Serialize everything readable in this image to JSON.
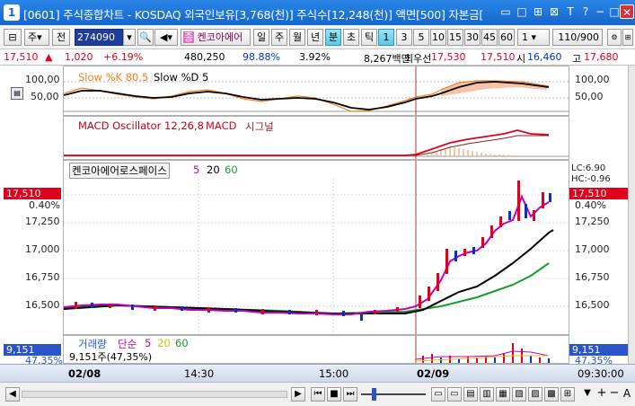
{
  "window": {
    "title": "[0601] 주식종합차트 - KOSDAQ 외국인보유[3,768(천)] 주식수[12,248(천)] 액면[500] 자본금[",
    "icon_label": "1",
    "buttons": [
      "▭",
      "□",
      "⊞",
      "⊠",
      "T",
      "?",
      "-",
      "□",
      "✕"
    ]
  },
  "toolbar": {
    "market": "주",
    "period_btn": "전",
    "code": "274090",
    "stock_name": "켄코아에어",
    "period_buttons": [
      "일",
      "주",
      "월",
      "년",
      "분",
      "초",
      "틱"
    ],
    "interval_buttons": [
      "1",
      "3",
      "5",
      "10",
      "15",
      "30",
      "45",
      "60"
    ],
    "multiplier": "1",
    "count": "110/900"
  },
  "infobar": {
    "price": "17,510",
    "arrow": "▲",
    "change": "1,020",
    "change_pct": "+6.19%",
    "volume": "480,250",
    "vol_ratio": "98.88%",
    "turnover": "3.92%",
    "amount": "8,267백만",
    "priority_label": "최우선",
    "ask": "17,530",
    "bid": "17,510",
    "open_label": "시",
    "open": "16,460",
    "high_label": "고",
    "high": "17,680"
  },
  "stoch": {
    "legend_k": "Slow %K 80,5",
    "legend_d": "Slow %D 5",
    "yticks": [
      "100,00",
      "50,00"
    ],
    "colors": {
      "k": "#f08020",
      "d": "#000000"
    }
  },
  "macd": {
    "legend_osc": "MACD Oscillator 12,26,8",
    "legend_macd": "MACD",
    "legend_signal": "시그널",
    "colors": {
      "macd": "#e0001b",
      "signal": "#8a2020"
    }
  },
  "price": {
    "legend_name": "켄코아에어로스페이스",
    "legend_ma": [
      "5",
      "20",
      "60"
    ],
    "ma_colors": [
      "#c000c0",
      "#000000",
      "#1a9a30"
    ],
    "yticks": [
      "17,250",
      "17,000",
      "16,750",
      "16,500"
    ],
    "current_tag": "17,510",
    "current_pct": "0.40%",
    "lc": "LC:6.90",
    "hc": "HC:-0.96"
  },
  "volume": {
    "legend_label": "거래량",
    "legend_simple": "단순",
    "legend_ma": [
      "5",
      "20",
      "60"
    ],
    "ma_colors": [
      "#c000c0",
      "#e0c000",
      "#1a9a30"
    ],
    "summary": "9,151주(47,35%)",
    "tag": "9,151",
    "tag_pct": "47,35%"
  },
  "axis": {
    "labels": [
      "02/08",
      "14:30",
      "15:00",
      "02/09",
      "09:30:00"
    ]
  }
}
